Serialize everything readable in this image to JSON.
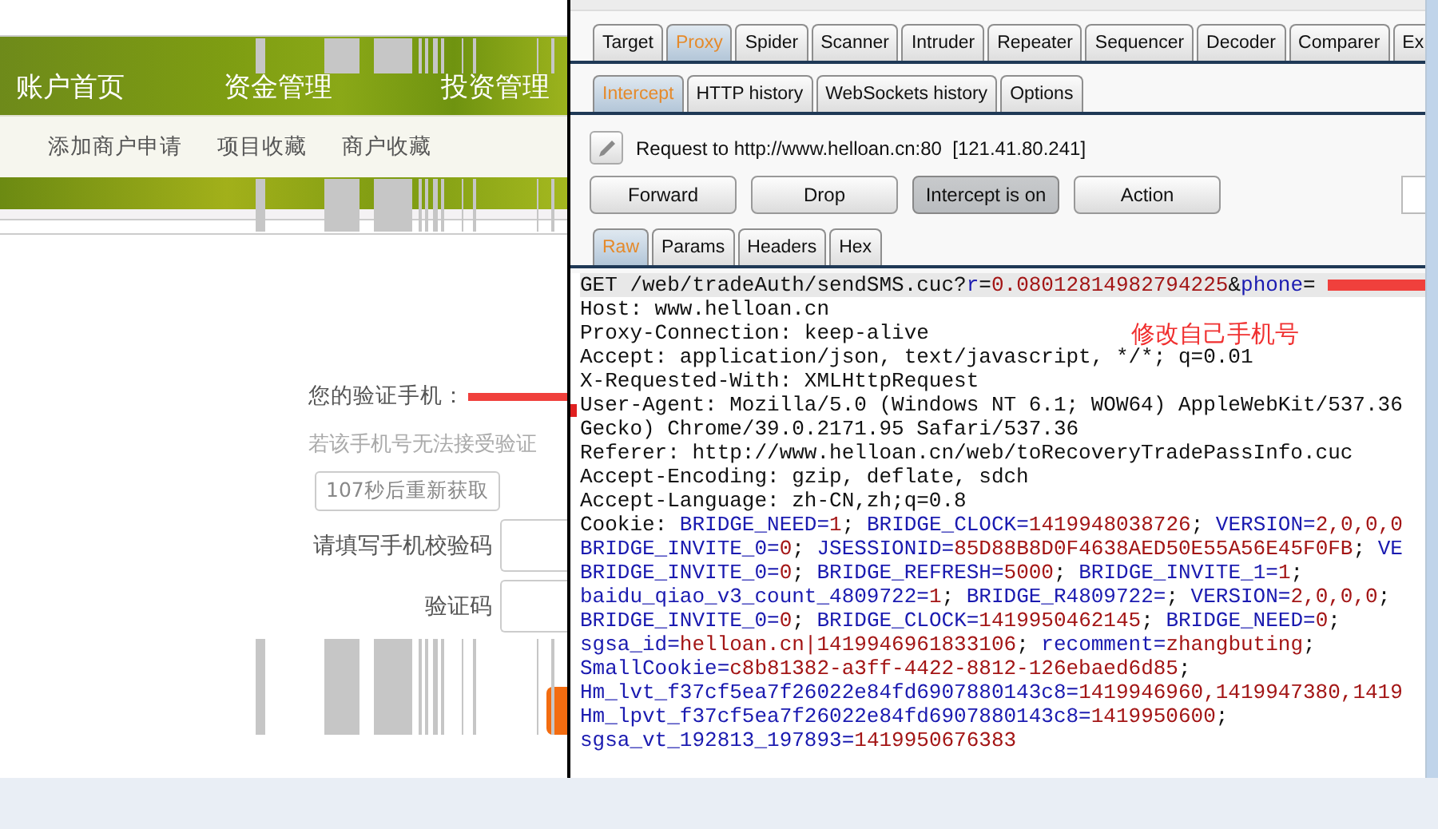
{
  "website": {
    "nav": [
      {
        "label": "账户首页"
      },
      {
        "label": "资金管理"
      },
      {
        "label": "投资管理"
      }
    ],
    "subnav": [
      {
        "label": "添加商户申请"
      },
      {
        "label": "项目收藏"
      },
      {
        "label": "商户收藏"
      }
    ],
    "phone_label": "您的验证手机：",
    "phone_redacted": true,
    "hint": "若该手机号无法接受验证",
    "resend_button": "107秒后重新获取",
    "fields": [
      {
        "label": "请填写手机校验码"
      },
      {
        "label": "验证码"
      }
    ]
  },
  "burp": {
    "tabs": [
      {
        "label": "Target",
        "selected": false
      },
      {
        "label": "Proxy",
        "selected": true
      },
      {
        "label": "Spider",
        "selected": false
      },
      {
        "label": "Scanner",
        "selected": false
      },
      {
        "label": "Intruder",
        "selected": false
      },
      {
        "label": "Repeater",
        "selected": false
      },
      {
        "label": "Sequencer",
        "selected": false
      },
      {
        "label": "Decoder",
        "selected": false
      },
      {
        "label": "Comparer",
        "selected": false
      },
      {
        "label": "Ex",
        "selected": false
      }
    ],
    "subtabs": [
      {
        "label": "Intercept",
        "selected": true
      },
      {
        "label": "HTTP history",
        "selected": false
      },
      {
        "label": "WebSockets history",
        "selected": false
      },
      {
        "label": "Options",
        "selected": false
      }
    ],
    "request_to": "Request to http://www.helloan.cn:80  [121.41.80.241]",
    "buttons": [
      {
        "label": "Forward",
        "pressed": false
      },
      {
        "label": "Drop",
        "pressed": false
      },
      {
        "label": "Intercept is on",
        "pressed": true
      },
      {
        "label": "Action",
        "pressed": false
      }
    ],
    "view_tabs": [
      {
        "label": "Raw",
        "selected": true
      },
      {
        "label": "Params",
        "selected": false
      },
      {
        "label": "Headers",
        "selected": false
      },
      {
        "label": "Hex",
        "selected": false
      }
    ],
    "annotation": "修改自己手机号",
    "request_lines": [
      {
        "highlighted": true,
        "redacted": true,
        "segments": [
          {
            "kind": "plain",
            "text": "GET /web/tradeAuth/sendSMS.cuc?"
          },
          {
            "kind": "name",
            "text": "r"
          },
          {
            "kind": "plain",
            "text": "="
          },
          {
            "kind": "value",
            "text": "0.08012814982794225"
          },
          {
            "kind": "plain",
            "text": "&"
          },
          {
            "kind": "name",
            "text": "phone"
          },
          {
            "kind": "plain",
            "text": "="
          }
        ]
      },
      {
        "highlighted": false,
        "redacted": false,
        "segments": [
          {
            "kind": "plain",
            "text": "Host: www.helloan.cn"
          }
        ]
      },
      {
        "highlighted": false,
        "redacted": false,
        "segments": [
          {
            "kind": "plain",
            "text": "Proxy-Connection: keep-alive"
          }
        ]
      },
      {
        "highlighted": false,
        "redacted": false,
        "segments": [
          {
            "kind": "plain",
            "text": "Accept: application/json, text/javascript, */*; q=0.01"
          }
        ]
      },
      {
        "highlighted": false,
        "redacted": false,
        "segments": [
          {
            "kind": "plain",
            "text": "X-Requested-With: XMLHttpRequest"
          }
        ]
      },
      {
        "highlighted": false,
        "redacted": false,
        "segments": [
          {
            "kind": "plain",
            "text": "User-Agent: Mozilla/5.0 (Windows NT 6.1; WOW64) AppleWebKit/537.36"
          }
        ]
      },
      {
        "highlighted": false,
        "redacted": false,
        "segments": [
          {
            "kind": "plain",
            "text": "Gecko) Chrome/39.0.2171.95 Safari/537.36"
          }
        ]
      },
      {
        "highlighted": false,
        "redacted": false,
        "segments": [
          {
            "kind": "plain",
            "text": "Referer: http://www.helloan.cn/web/toRecoveryTradePassInfo.cuc"
          }
        ]
      },
      {
        "highlighted": false,
        "redacted": false,
        "segments": [
          {
            "kind": "plain",
            "text": "Accept-Encoding: gzip, deflate, sdch"
          }
        ]
      },
      {
        "highlighted": false,
        "redacted": false,
        "segments": [
          {
            "kind": "plain",
            "text": "Accept-Language: zh-CN,zh;q=0.8"
          }
        ]
      },
      {
        "highlighted": false,
        "redacted": false,
        "segments": [
          {
            "kind": "plain",
            "text": "Cookie: "
          },
          {
            "kind": "name",
            "text": "BRIDGE_NEED="
          },
          {
            "kind": "value",
            "text": "1"
          },
          {
            "kind": "plain",
            "text": "; "
          },
          {
            "kind": "name",
            "text": "BRIDGE_CLOCK="
          },
          {
            "kind": "value",
            "text": "1419948038726"
          },
          {
            "kind": "plain",
            "text": "; "
          },
          {
            "kind": "name",
            "text": "VERSION="
          },
          {
            "kind": "value",
            "text": "2,0,0,0"
          }
        ]
      },
      {
        "highlighted": false,
        "redacted": false,
        "segments": [
          {
            "kind": "name",
            "text": "BRIDGE_INVITE_0="
          },
          {
            "kind": "value",
            "text": "0"
          },
          {
            "kind": "plain",
            "text": "; "
          },
          {
            "kind": "name",
            "text": "JSESSIONID="
          },
          {
            "kind": "value",
            "text": "85D88B8D0F4638AED50E55A56E45F0FB"
          },
          {
            "kind": "plain",
            "text": "; "
          },
          {
            "kind": "name",
            "text": "VE"
          }
        ]
      },
      {
        "highlighted": false,
        "redacted": false,
        "segments": [
          {
            "kind": "name",
            "text": "BRIDGE_INVITE_0="
          },
          {
            "kind": "value",
            "text": "0"
          },
          {
            "kind": "plain",
            "text": "; "
          },
          {
            "kind": "name",
            "text": "BRIDGE_REFRESH="
          },
          {
            "kind": "value",
            "text": "5000"
          },
          {
            "kind": "plain",
            "text": "; "
          },
          {
            "kind": "name",
            "text": "BRIDGE_INVITE_1="
          },
          {
            "kind": "value",
            "text": "1"
          },
          {
            "kind": "plain",
            "text": ";"
          }
        ]
      },
      {
        "highlighted": false,
        "redacted": false,
        "segments": [
          {
            "kind": "name",
            "text": "baidu_qiao_v3_count_4809722="
          },
          {
            "kind": "value",
            "text": "1"
          },
          {
            "kind": "plain",
            "text": "; "
          },
          {
            "kind": "name",
            "text": "BRIDGE_R4809722="
          },
          {
            "kind": "plain",
            "text": "; "
          },
          {
            "kind": "name",
            "text": "VERSION="
          },
          {
            "kind": "value",
            "text": "2,0,0,0"
          },
          {
            "kind": "plain",
            "text": ";"
          }
        ]
      },
      {
        "highlighted": false,
        "redacted": false,
        "segments": [
          {
            "kind": "name",
            "text": "BRIDGE_INVITE_0="
          },
          {
            "kind": "value",
            "text": "0"
          },
          {
            "kind": "plain",
            "text": "; "
          },
          {
            "kind": "name",
            "text": "BRIDGE_CLOCK="
          },
          {
            "kind": "value",
            "text": "1419950462145"
          },
          {
            "kind": "plain",
            "text": "; "
          },
          {
            "kind": "name",
            "text": "BRIDGE_NEED="
          },
          {
            "kind": "value",
            "text": "0"
          },
          {
            "kind": "plain",
            "text": ";"
          }
        ]
      },
      {
        "highlighted": false,
        "redacted": false,
        "segments": [
          {
            "kind": "name",
            "text": "sgsa_id="
          },
          {
            "kind": "value",
            "text": "helloan.cn|1419946961833106"
          },
          {
            "kind": "plain",
            "text": "; "
          },
          {
            "kind": "name",
            "text": "recomment="
          },
          {
            "kind": "value",
            "text": "zhangbuting"
          },
          {
            "kind": "plain",
            "text": ";"
          }
        ]
      },
      {
        "highlighted": false,
        "redacted": false,
        "segments": [
          {
            "kind": "name",
            "text": "SmallCookie="
          },
          {
            "kind": "value",
            "text": "c8b81382-a3ff-4422-8812-126ebaed6d85"
          },
          {
            "kind": "plain",
            "text": ";"
          }
        ]
      },
      {
        "highlighted": false,
        "redacted": false,
        "segments": [
          {
            "kind": "name",
            "text": "Hm_lvt_f37cf5ea7f26022e84fd6907880143c8="
          },
          {
            "kind": "value",
            "text": "1419946960,1419947380,1419"
          }
        ]
      },
      {
        "highlighted": false,
        "redacted": false,
        "segments": [
          {
            "kind": "name",
            "text": "Hm_lpvt_f37cf5ea7f26022e84fd6907880143c8="
          },
          {
            "kind": "value",
            "text": "1419950600"
          },
          {
            "kind": "plain",
            "text": ";"
          }
        ]
      },
      {
        "highlighted": false,
        "redacted": false,
        "segments": [
          {
            "kind": "name",
            "text": "sgsa_vt_192813_197893="
          },
          {
            "kind": "value",
            "text": "1419950676383"
          }
        ]
      }
    ]
  }
}
